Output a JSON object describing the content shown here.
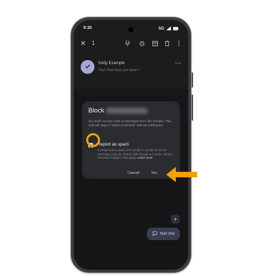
{
  "status_bar": {
    "time": "9:30",
    "network": "5G",
    "camera_icon": "front-camera",
    "signal_icon": "signal-icon",
    "battery_icon": "battery-icon"
  },
  "toolbar": {
    "close_icon": "close-icon",
    "selected_count": "1",
    "actions": [
      "pin-icon",
      "snooze-icon",
      "archive-icon",
      "delete-icon",
      "more-icon"
    ]
  },
  "conversation": {
    "contact_name": "Kelly Example",
    "preview": "Hey! How have you been?",
    "time": "Now",
    "avatar_icon": "check-icon"
  },
  "dialog": {
    "title": "Block",
    "body": "You won't receive calls or messages from this number. This chat will stay in \"Spam & blocked\" without notification.",
    "checkbox_label": "Report as spam",
    "checkbox_checked": true,
    "checkbox_description": "To help reduce spam, the sender's number & recent messages may be shared with Google & mobile carriers. Standard charges may apply.",
    "learn_more": "Learn more",
    "cancel_label": "Cancel",
    "confirm_label": "Yes"
  },
  "fab": {
    "add_icon": "plus-icon",
    "start_chat_label": "Start chat",
    "start_chat_icon": "chat-bubble-icon"
  },
  "annotations": {
    "color": "#F4A000",
    "arrow_icon": "arrow-left-icon"
  }
}
